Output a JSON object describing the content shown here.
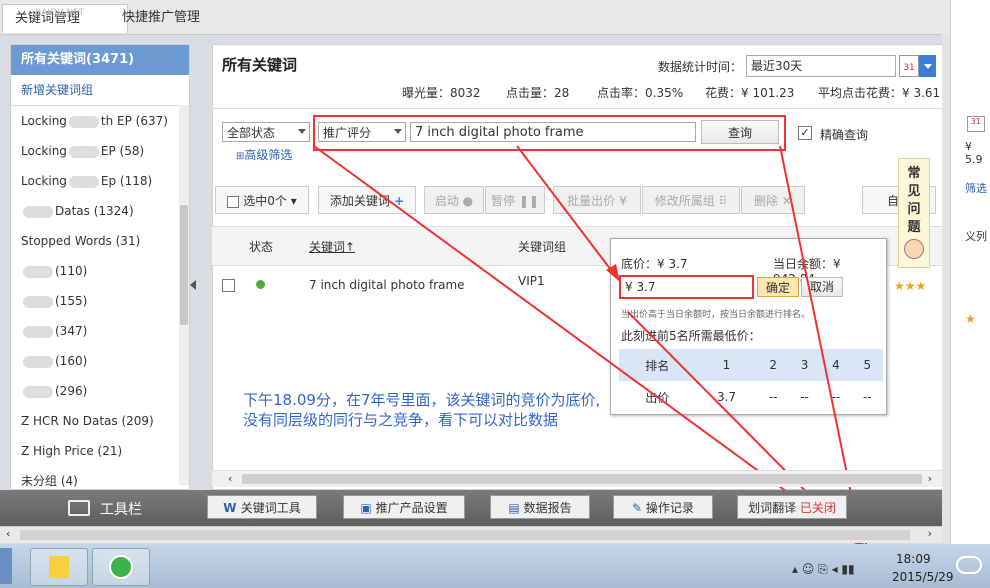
{
  "tabs": {
    "keyword_mgmt": "关键词管理",
    "watermark": "BAIDU NET",
    "quick_promo": "快捷推广管理"
  },
  "sidebar": {
    "all_keywords": "所有关键词(3471)",
    "new_group": "新增关键词组",
    "items": [
      {
        "pre": "Locking",
        "post": "th EP (637)"
      },
      {
        "pre": "Locking",
        "post": "EP (58)"
      },
      {
        "pre": "Locking",
        "post": "Ep (118)"
      },
      {
        "pre": "",
        "post": "Datas (1324)"
      },
      {
        "pre": "Stopped Words (31)",
        "post": ""
      },
      {
        "pre": "",
        "post": "(110)"
      },
      {
        "pre": "",
        "post": "(155)"
      },
      {
        "pre": "",
        "post": "(347)"
      },
      {
        "pre": "",
        "post": "(160)"
      },
      {
        "pre": "",
        "post": "(296)"
      },
      {
        "pre": "Z HCR No Datas (209)",
        "post": ""
      },
      {
        "pre": "Z High Price (21)",
        "post": ""
      },
      {
        "pre": "未分组 (4)",
        "post": ""
      }
    ]
  },
  "main": {
    "title": "所有关键词",
    "stat_time_label": "数据统计时间：",
    "stat_time_value": "最近30天",
    "calendar_day": "31",
    "stats": {
      "impressions": "曝光量：8032",
      "clicks": "点击量：28",
      "ctr": "点击率：0.35%",
      "cost": "花费：¥ 101.23",
      "avg_cpc": "平均点击花费：¥ 3.61"
    },
    "filter": {
      "status": "全部状态",
      "score": "推广评分",
      "search_value": "7 inch digital photo frame",
      "query_btn": "查询",
      "exact_label": "精确查询",
      "advanced": "高级筛选"
    },
    "actions": {
      "select": "选中0个",
      "add": "添加关键词",
      "start": "启动",
      "pause": "暂停",
      "bulk_bid": "批量出价",
      "bid_symbol": "¥",
      "modify_group": "修改所属组",
      "delete": "删除",
      "custom": "自定"
    },
    "table": {
      "headers": {
        "status": "状态",
        "keyword": "关键词",
        "group": "关键词组"
      },
      "row": {
        "keyword": "7 inch digital photo frame",
        "group": "VIP1"
      }
    }
  },
  "popup": {
    "floor": "底价：¥ 3.7",
    "balance": "当日余额：¥ 942.84",
    "input": "¥ 3.7",
    "confirm": "确定",
    "cancel": "取消",
    "note": "当出价高于当日余额时，按当日余额进行排名。",
    "top5_label": "此刻进前5名所需最低价：",
    "rank_header": [
      "排名",
      "1",
      "2",
      "3",
      "4",
      "5"
    ],
    "bid_row": [
      "出价",
      "3.7",
      "--",
      "--",
      "--",
      "--"
    ]
  },
  "annotation": {
    "line1": "下午18.09分，在7年号里面，该关键词的竞价为底价,",
    "line2": "没有同层级的同行与之竞争，看下可以对比数据"
  },
  "faq": "常见问题",
  "stars": "★★★",
  "right_edge": {
    "price": "¥ 5.9",
    "filter": "筛选",
    "list": "义列"
  },
  "bottombar": {
    "title": "工具栏",
    "kw_tool": "关键词工具",
    "promo_settings": "推广产品设置",
    "report": "数据报告",
    "log": "操作记录",
    "translate": "划词翻译",
    "translate_state": "已关闭"
  },
  "taskbar": {
    "time": "18:09",
    "date": "2015/5/29"
  },
  "colors": {
    "accent": "#6b9bd2",
    "annotation": "#3366cc",
    "highlight": "#e33333",
    "status_green": "#4caf3a"
  }
}
